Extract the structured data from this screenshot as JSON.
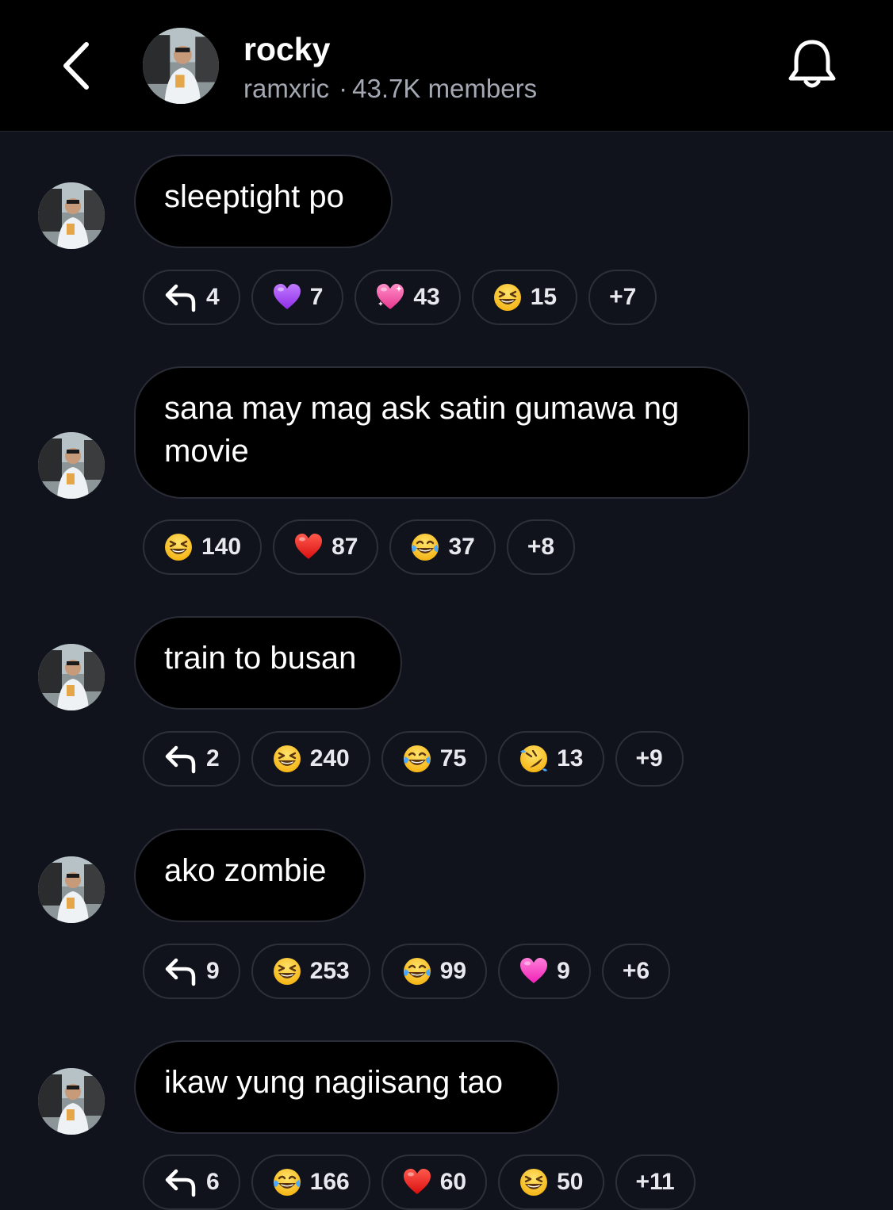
{
  "header": {
    "title": "rocky",
    "username": "ramxric",
    "separator": "·",
    "members": "43.7K members"
  },
  "messages": [
    {
      "text": "sleeptight po",
      "reactions": [
        {
          "icon": "reply-icon",
          "count": "4"
        },
        {
          "icon": "purple-heart-icon",
          "count": "7"
        },
        {
          "icon": "sparkling-heart-icon",
          "count": "43"
        },
        {
          "icon": "grinning-squinting-face-icon",
          "count": "15"
        },
        {
          "icon": "more",
          "count": "+7"
        }
      ]
    },
    {
      "text": "sana may mag ask satin gumawa ng movie",
      "reactions": [
        {
          "icon": "grinning-squinting-face-icon",
          "count": "140"
        },
        {
          "icon": "red-heart-icon",
          "count": "87"
        },
        {
          "icon": "tears-of-joy-face-icon",
          "count": "37"
        },
        {
          "icon": "more",
          "count": "+8"
        }
      ]
    },
    {
      "text": "train to busan",
      "reactions": [
        {
          "icon": "reply-icon",
          "count": "2"
        },
        {
          "icon": "grinning-squinting-face-icon",
          "count": "240"
        },
        {
          "icon": "tears-of-joy-face-icon",
          "count": "75"
        },
        {
          "icon": "rolling-laughing-face-icon",
          "count": "13"
        },
        {
          "icon": "more",
          "count": "+9"
        }
      ]
    },
    {
      "text": "ako zombie",
      "reactions": [
        {
          "icon": "reply-icon",
          "count": "9"
        },
        {
          "icon": "grinning-squinting-face-icon",
          "count": "253"
        },
        {
          "icon": "tears-of-joy-face-icon",
          "count": "99"
        },
        {
          "icon": "pink-heart-icon",
          "count": "9"
        },
        {
          "icon": "more",
          "count": "+6"
        }
      ]
    },
    {
      "text": "ikaw yung nagiisang tao",
      "reactions": [
        {
          "icon": "reply-icon",
          "count": "6"
        },
        {
          "icon": "tears-of-joy-face-icon",
          "count": "166"
        },
        {
          "icon": "red-heart-icon",
          "count": "60"
        },
        {
          "icon": "grinning-squinting-face-icon",
          "count": "50"
        },
        {
          "icon": "more",
          "count": "+11"
        }
      ]
    }
  ],
  "colors": {
    "background": "#10131c",
    "header_background": "#000000",
    "bubble_background": "#000000",
    "chip_border": "#2d3039",
    "secondary_text": "#a4a8b3"
  }
}
